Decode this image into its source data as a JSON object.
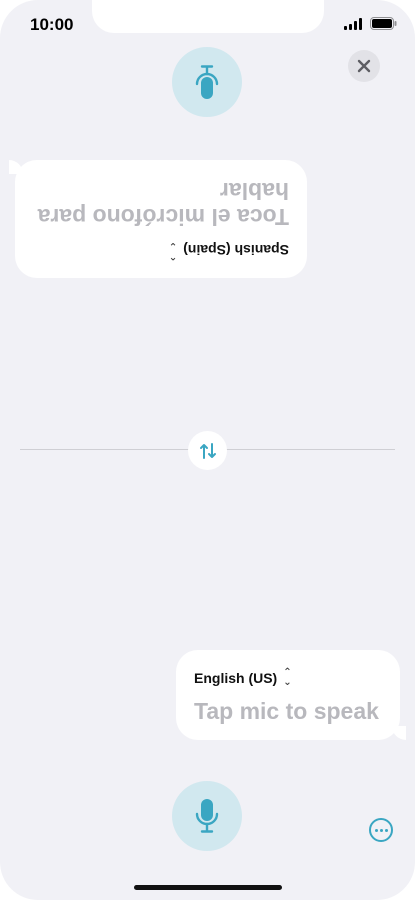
{
  "status_bar": {
    "time": "10:00",
    "icons": [
      "signal-icon",
      "battery-icon"
    ]
  },
  "colors": {
    "accent": "#3aa6c2",
    "mic_background": "#d1e8ef",
    "screen_background": "#f1f1f6",
    "placeholder_text": "#b8b8bd"
  },
  "top_panel": {
    "orientation": "upside-down",
    "language": "Spanish (Spain)",
    "prompt": "Toca el micrófono para hablar"
  },
  "bottom_panel": {
    "language": "English (US)",
    "prompt": "Tap mic to speak"
  },
  "controls": {
    "close": "close-icon",
    "swap": "swap-arrows-icon",
    "more": "ellipsis-circle-icon",
    "mic": "microphone-icon"
  }
}
